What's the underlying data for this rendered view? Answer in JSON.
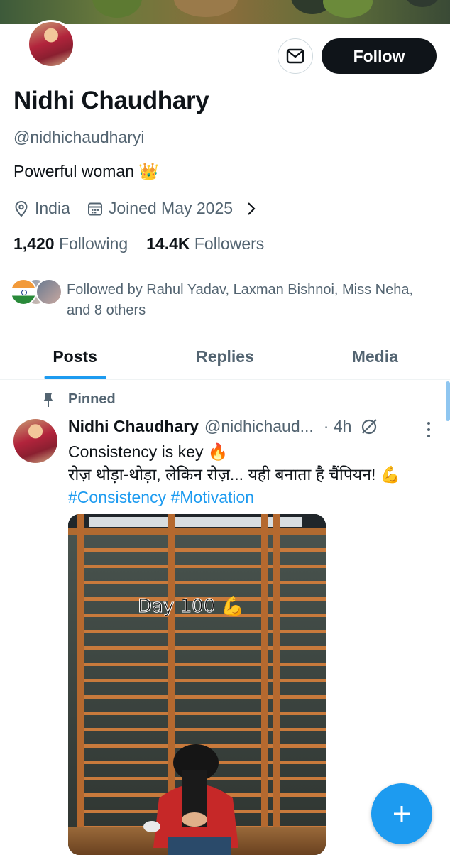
{
  "profile": {
    "name": "Nidhi Chaudhary",
    "handle": "@nidhichaudharyi",
    "bio": "Powerful woman",
    "bio_emoji": "👑",
    "location": "India",
    "joined": "Joined May 2025",
    "following_count": "1,420",
    "following_label": "Following",
    "followers_count": "14.4K",
    "followers_label": "Followers",
    "followed_by": "Followed by Rahul Yadav, Laxman Bishnoi, Miss Neha, and 8 others"
  },
  "actions": {
    "follow_label": "Follow",
    "message_icon": "envelope-icon"
  },
  "tabs": [
    {
      "label": "Posts",
      "active": true
    },
    {
      "label": "Replies",
      "active": false
    },
    {
      "label": "Media",
      "active": false
    }
  ],
  "post": {
    "pinned_label": "Pinned",
    "author_name": "Nidhi Chaudhary",
    "author_handle": "@nidhichaud...",
    "time": "· 4h",
    "line1": "Consistency is key 🔥",
    "line2": "रोज़ थोड़ा-थोड़ा, लेकिन रोज़... यही बनाता है चैंपियन! 💪",
    "hashtags": "#Consistency #Motivation",
    "media_caption": "Day 100 💪"
  },
  "colors": {
    "accent": "#1d9bf0",
    "text": "#0f1419",
    "muted": "#536471"
  }
}
